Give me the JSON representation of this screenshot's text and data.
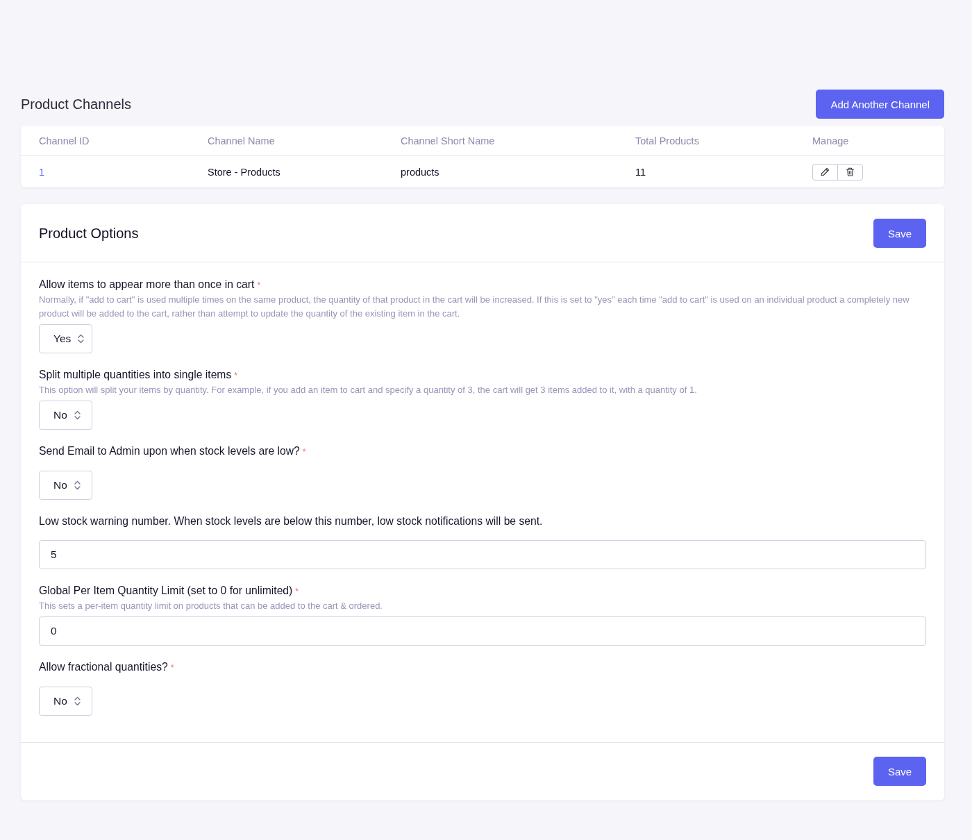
{
  "channels_section": {
    "title": "Product Channels",
    "add_button": "Add Another Channel",
    "table": {
      "columns": [
        "Channel ID",
        "Channel Name",
        "Channel Short Name",
        "Total Products",
        "Manage"
      ],
      "rows": [
        {
          "channel_id": "1",
          "channel_name": "Store - Products",
          "short_name": "products",
          "total_products": "11"
        }
      ]
    }
  },
  "options_panel": {
    "title": "Product Options",
    "save_button": "Save",
    "fields": [
      {
        "kind": "select",
        "label": "Allow items to appear more than once in cart",
        "required_mark": "*",
        "help": "Normally, if \"add to cart\" is used multiple times on the same product, the quantity of that product in the cart will be increased. If this is set to \"yes\" each time \"add to cart\" is used on an individual product a completely new product will be added to the cart, rather than attempt to update the quantity of the existing item in the cart.",
        "value": "Yes"
      },
      {
        "kind": "select",
        "label": "Split multiple quantities into single items",
        "required_mark": "*",
        "help": "This option will split your items by quantity. For example, if you add an item to cart and specify a quantity of 3, the cart will get 3 items added to it, with a quantity of 1.",
        "value": "No"
      },
      {
        "kind": "select",
        "label": "Send Email to Admin upon when stock levels are low?",
        "required_mark": "*",
        "value": "No"
      },
      {
        "kind": "text",
        "label": "Low stock warning number. When stock levels are below this number, low stock notifications will be sent.",
        "value": "5"
      },
      {
        "kind": "text",
        "label": "Global Per Item Quantity Limit (set to 0 for unlimited)",
        "required_mark": "*",
        "help": "This sets a per-item quantity limit on products that can be added to the cart & ordered.",
        "value": "0"
      },
      {
        "kind": "select",
        "label": "Allow fractional quantities?",
        "required_mark": "*",
        "value": "No"
      }
    ],
    "footer_save_button": "Save"
  }
}
